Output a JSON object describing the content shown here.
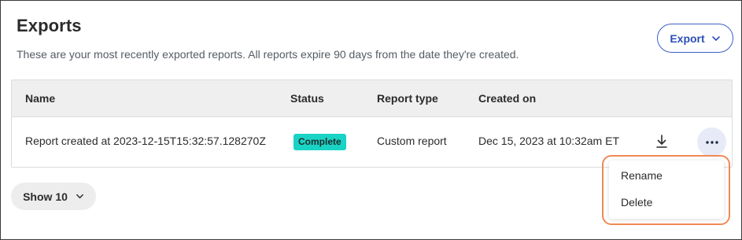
{
  "page": {
    "title": "Exports",
    "subtitle": "These are your most recently exported reports. All reports expire 90 days from the date they're created."
  },
  "export_button": {
    "label": "Export",
    "icon": "chevron-down-icon"
  },
  "table": {
    "columns": [
      "Name",
      "Status",
      "Report type",
      "Created on"
    ],
    "rows": [
      {
        "name": "Report created at 2023-12-15T15:32:57.128270Z",
        "status": "Complete",
        "report_type": "Custom report",
        "created_on": "Dec 15, 2023 at 10:32am ET",
        "download_icon": "download-icon",
        "more_icon": "more-horizontal-icon"
      }
    ]
  },
  "pagination": {
    "show_label": "Show 10",
    "icon": "chevron-down-icon"
  },
  "row_menu": {
    "items": [
      "Rename",
      "Delete"
    ]
  },
  "colors": {
    "accent": "#2c4fb8",
    "status_complete": "#19d3c5",
    "highlight": "#ef8a55",
    "header_bg": "#efeff0"
  }
}
